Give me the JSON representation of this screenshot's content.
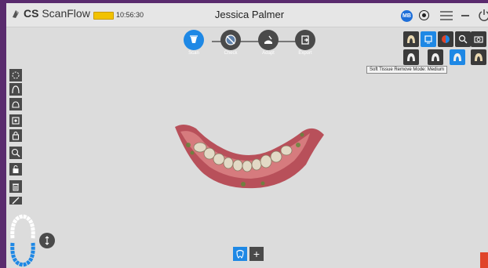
{
  "app": {
    "name_bold": "CS",
    "name_rest": " ScanFlow",
    "time": "10:56:30",
    "patient_name": "Jessica Palmer",
    "user_badge": "MB",
    "battery_color": "#f2c200"
  },
  "workflow": {
    "steps": [
      {
        "label": "Scan",
        "icon": "scanner-icon",
        "active": true
      },
      {
        "label": "Check",
        "icon": "check-tool-icon",
        "active": false
      },
      {
        "label": "Adapt",
        "icon": "adapt-icon",
        "active": false
      },
      {
        "label": "Export",
        "icon": "export-icon",
        "active": false
      }
    ]
  },
  "right_toolbar": {
    "row1": [
      "tooth-model-icon",
      "display-mode-icon",
      "color-mode-icon",
      "zoom-icon",
      "camera-icon"
    ],
    "row2": [
      "soft-tissue-low-icon",
      "soft-tissue-high-icon",
      "soft-tissue-medium-icon",
      "soft-tissue-off-icon"
    ],
    "tooltip": "Soft Tissue Remove Mode: Medium"
  },
  "left_toolbar": {
    "tools": [
      "select-tool-icon",
      "arch-icon",
      "tooth-preparation-icon",
      "margin-icon",
      "lock-icon",
      "zoom-area-icon",
      "unlock-icon",
      "trash-icon",
      "edit-icon"
    ]
  },
  "bottom": {
    "plus_label": "+",
    "active_color": "#1e88e5",
    "accent_red": "#e0442a"
  }
}
